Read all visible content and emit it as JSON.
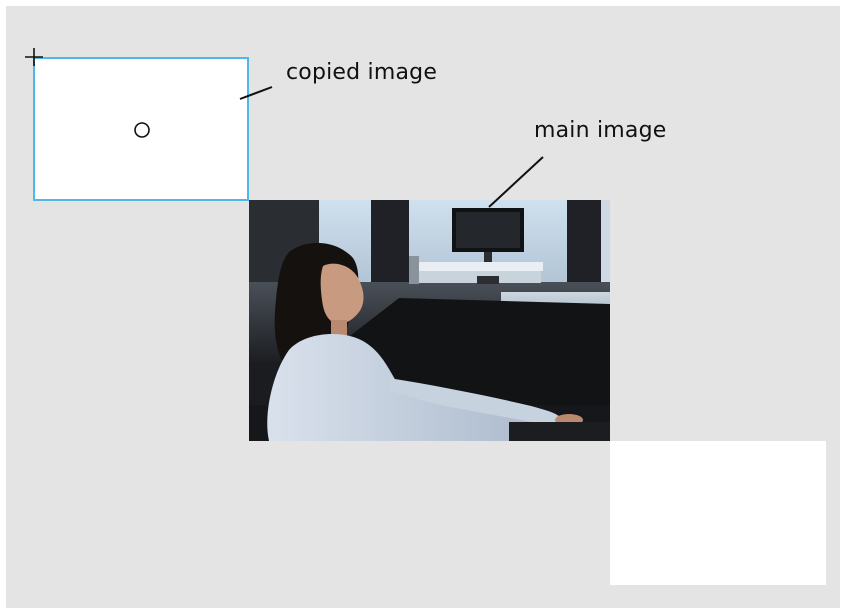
{
  "labels": {
    "copied_image": "copied image",
    "main_image": "main image"
  },
  "colors": {
    "canvas_background": "#e4e4e4",
    "selection_border": "#4fb8ea",
    "annotation_text": "#111111"
  },
  "icons": {
    "cursor": "crosshair-icon",
    "origin_marker": "circle-icon"
  }
}
